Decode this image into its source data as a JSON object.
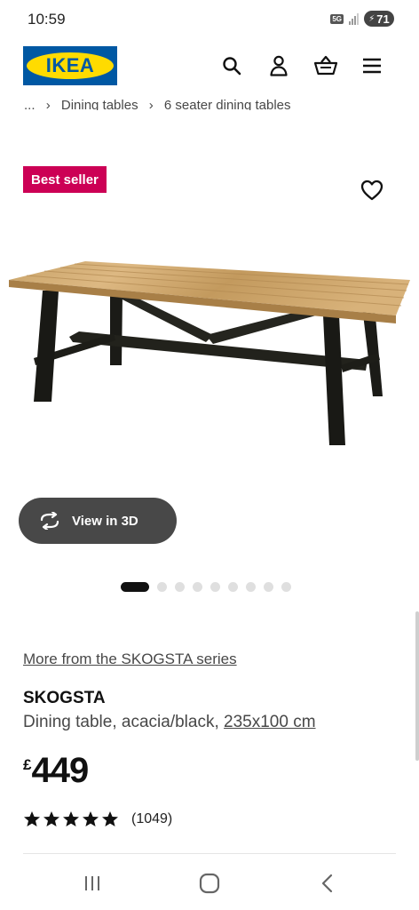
{
  "status_bar": {
    "time": "10:59",
    "network": "5G",
    "battery": "71"
  },
  "header": {
    "logo_text": "IKEA",
    "brand_colors": {
      "blue": "#0058a3",
      "yellow": "#ffdb00"
    },
    "icons": [
      "search-icon",
      "account-icon",
      "basket-icon",
      "menu-icon"
    ]
  },
  "breadcrumb": {
    "items": [
      "...",
      "Dining tables",
      "6 seater dining tables"
    ]
  },
  "product": {
    "badge": "Best seller",
    "badge_color": "#cc0055",
    "view_3d_label": "View in 3D",
    "carousel": {
      "total_images": 9,
      "active_index": 0
    },
    "series_link": "More from the SKOGSTA series",
    "name": "SKOGSTA",
    "description": "Dining table, acacia/black,",
    "size": "235x100 cm",
    "currency": "£",
    "price": "449",
    "rating": {
      "stars": 5,
      "count": "(1049)"
    }
  },
  "nav_bar": {
    "buttons": [
      "recent-apps-icon",
      "home-icon",
      "back-icon"
    ]
  }
}
